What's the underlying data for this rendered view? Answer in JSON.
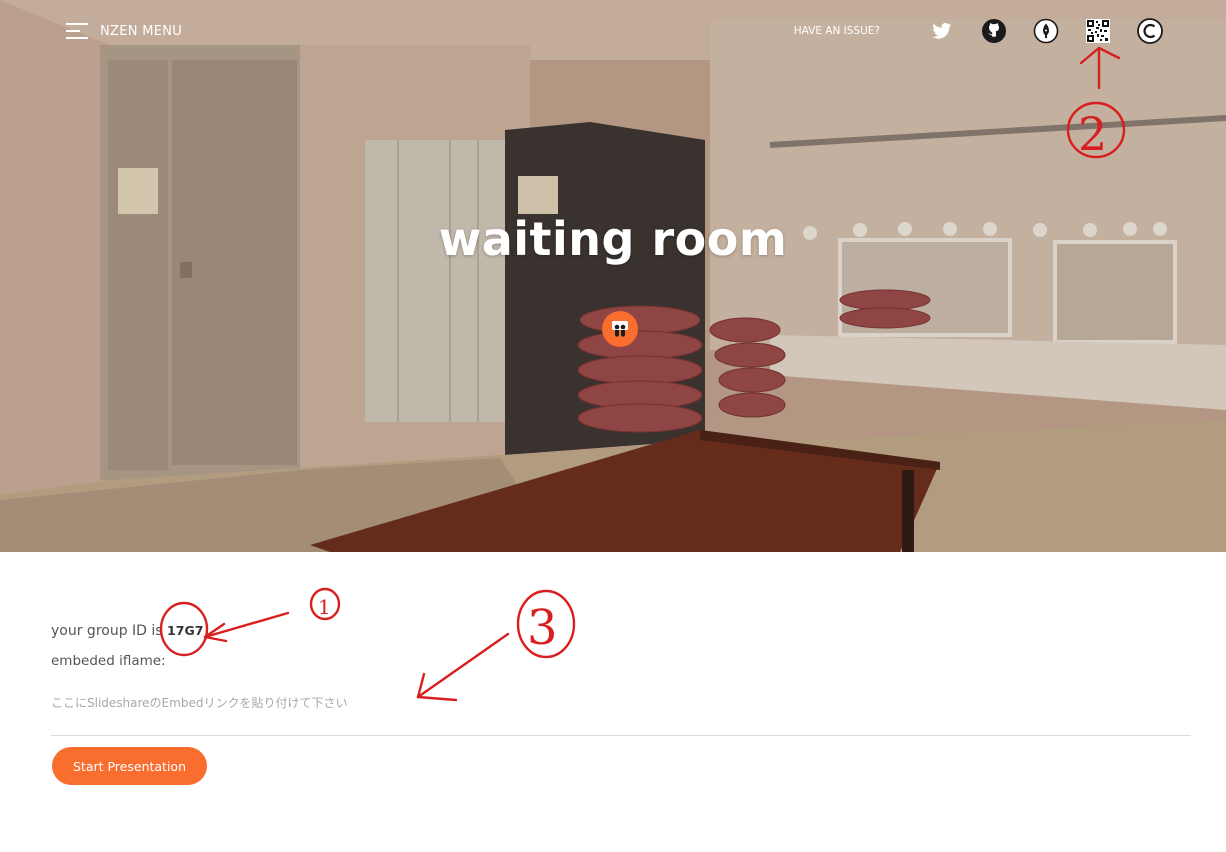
{
  "header": {
    "menu_label": "NZEN MENU",
    "issue_label": "HAVE AN ISSUE?",
    "icons": [
      "hamburger-icon",
      "twitter-icon",
      "github-icon",
      "pen-nib-icon",
      "qr-code-icon",
      "copyright-icon"
    ]
  },
  "hero": {
    "title": "waiting room",
    "icon": "slideshare-icon"
  },
  "content": {
    "group_prefix": "your group ID is",
    "group_id": "17G7",
    "iframe_label": "embeded iflame:",
    "embed_placeholder": "ここにSlideshareのEmbedリンクを貼り付けて下さい",
    "start_button": "Start Presentation"
  },
  "annotations": [
    "①",
    "②",
    "③"
  ],
  "colors": {
    "accent": "#f96d2f",
    "annotation": "#d81f1f",
    "text": "#555555"
  }
}
